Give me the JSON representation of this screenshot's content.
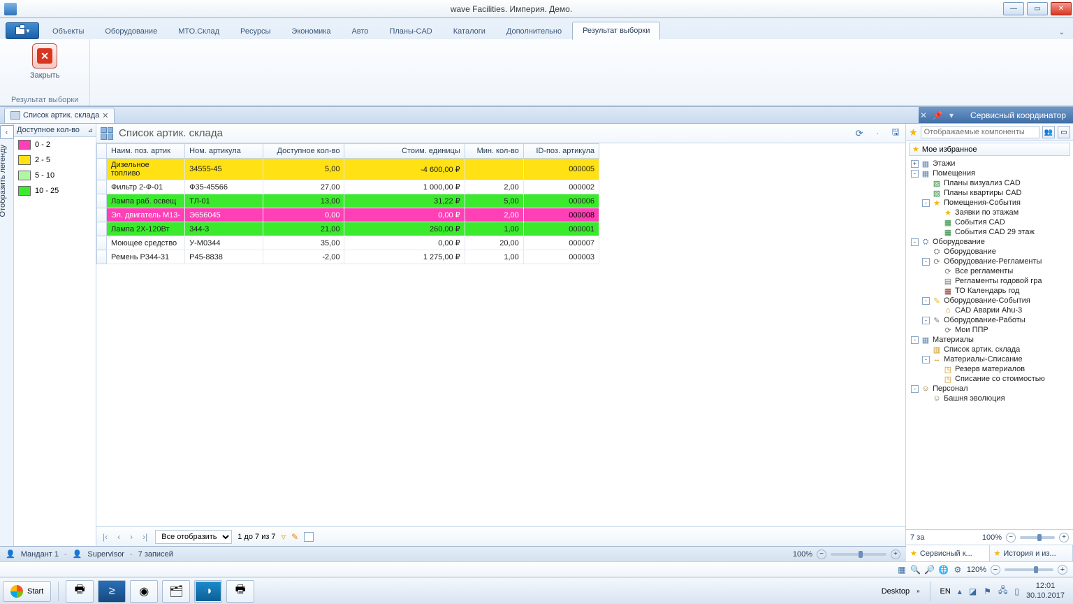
{
  "window": {
    "title": "wave Facilities. Империя. Демо."
  },
  "ribbon": {
    "tabs": [
      "Объекты",
      "Оборудование",
      "МТО.Склад",
      "Ресурсы",
      "Экономика",
      "Авто",
      "Планы-CAD",
      "Каталоги",
      "Дополнительно",
      "Результат выборки"
    ],
    "active_tab": "Результат выборки",
    "close_label": "Закрыть",
    "group_caption": "Результат выборки"
  },
  "doc_tab": {
    "title": "Список артик. склада"
  },
  "right_panel_title": "Сервисный координатор",
  "legend": {
    "header": "Доступное кол-во",
    "toggle_label": "Отобразить легенду",
    "items": [
      {
        "swatch": "sw-pink",
        "label": "0 - 2"
      },
      {
        "swatch": "sw-yellow",
        "label": "2 - 5"
      },
      {
        "swatch": "sw-lgreen",
        "label": "5 - 10"
      },
      {
        "swatch": "sw-green",
        "label": "10 - 25"
      }
    ]
  },
  "table": {
    "title": "Список артик. склада",
    "columns": [
      "Наим. поз. артик",
      "Ном. артикула",
      "Доступное кол-во",
      "Стоим. единицы",
      "Мин. кол-во",
      "ID-поз. артикула"
    ],
    "rows": [
      {
        "cls": "c-yellow",
        "cells": [
          "Дизельное топливо",
          "34555-45",
          "5,00",
          "-4 600,00 ₽",
          "",
          "000005"
        ]
      },
      {
        "cls": "",
        "cells": [
          "Фильтр 2-Ф-01",
          "Ф35-45566",
          "27,00",
          "1 000,00 ₽",
          "2,00",
          "000002"
        ]
      },
      {
        "cls": "c-green",
        "cells": [
          "Лампа раб. освещ",
          "ТЛ-01",
          "13,00",
          "31,22 ₽",
          "5,00",
          "000006"
        ]
      },
      {
        "cls": "c-pink",
        "cells": [
          "Эл. двигатель М13-",
          "Э656045",
          "0,00",
          "0,00 ₽",
          "2,00",
          "000008"
        ]
      },
      {
        "cls": "c-green",
        "cells": [
          "Лампа 2Х-120Вт",
          "344-3",
          "21,00",
          "260,00 ₽",
          "1,00",
          "000001"
        ]
      },
      {
        "cls": "",
        "cells": [
          "Моющее средство",
          "У-М0344",
          "35,00",
          "0,00 ₽",
          "20,00",
          "000007"
        ]
      },
      {
        "cls": "",
        "cells": [
          "Ремень Р344-31",
          "Р45-8838",
          "-2,00",
          "1 275,00 ₽",
          "1,00",
          "000003"
        ]
      }
    ]
  },
  "pager": {
    "show_all": "Все отобразить",
    "range": "1 до 7 из 7"
  },
  "statusbar": {
    "mandant": "Мандант 1",
    "user": "Supervisor",
    "records": "7 записей",
    "zoom": "100%"
  },
  "sidebar": {
    "search_placeholder": "Отображаемые компоненты",
    "favorites_header": "Мое избранное",
    "tree": [
      {
        "pm": "+",
        "ind": 0,
        "icon": "i-folder",
        "glyph": "▦",
        "label": "Этажи"
      },
      {
        "pm": "-",
        "ind": 0,
        "icon": "i-folder",
        "glyph": "▦",
        "label": "Помещения"
      },
      {
        "pm": "",
        "ind": 1,
        "icon": "i-cad",
        "glyph": "▧",
        "label": "Планы визуализ CAD"
      },
      {
        "pm": "",
        "ind": 1,
        "icon": "i-cad",
        "glyph": "▧",
        "label": "Планы квартиры CAD"
      },
      {
        "pm": "-",
        "ind": 1,
        "icon": "i-star",
        "glyph": "★",
        "label": "Помещения-События"
      },
      {
        "pm": "",
        "ind": 2,
        "icon": "i-star",
        "glyph": "★",
        "label": "Заявки по этажам"
      },
      {
        "pm": "",
        "ind": 2,
        "icon": "i-cad",
        "glyph": "▦",
        "label": "События CAD"
      },
      {
        "pm": "",
        "ind": 2,
        "icon": "i-cad",
        "glyph": "▦",
        "label": "События CAD 29 этаж"
      },
      {
        "pm": "-",
        "ind": 0,
        "icon": "i-folder",
        "glyph": "⛭",
        "label": "Оборудование"
      },
      {
        "pm": "",
        "ind": 1,
        "icon": "i-gear",
        "glyph": "⛭",
        "label": "Оборудование"
      },
      {
        "pm": "-",
        "ind": 1,
        "icon": "i-gear",
        "glyph": "⟳",
        "label": "Оборудование-Регламенты"
      },
      {
        "pm": "",
        "ind": 2,
        "icon": "i-gear",
        "glyph": "⟳",
        "label": "Все регламенты"
      },
      {
        "pm": "",
        "ind": 2,
        "icon": "i-gear",
        "glyph": "▤",
        "label": "Регламенты годовой гра"
      },
      {
        "pm": "",
        "ind": 2,
        "icon": "i-cal",
        "glyph": "▦",
        "label": "ТО Календарь год"
      },
      {
        "pm": "-",
        "ind": 1,
        "icon": "i-star",
        "glyph": "✎",
        "label": "Оборудование-События"
      },
      {
        "pm": "",
        "ind": 2,
        "icon": "i-box",
        "glyph": "⌂",
        "label": "CAD Аварии Ahu-3"
      },
      {
        "pm": "-",
        "ind": 1,
        "icon": "i-gear",
        "glyph": "✎",
        "label": "Оборудование-Работы"
      },
      {
        "pm": "",
        "ind": 2,
        "icon": "i-gear",
        "glyph": "⟳",
        "label": "Мои ППР"
      },
      {
        "pm": "-",
        "ind": 0,
        "icon": "i-folder",
        "glyph": "▦",
        "label": "Материалы"
      },
      {
        "pm": "",
        "ind": 1,
        "icon": "i-box",
        "glyph": "▥",
        "label": "Список артик. склада"
      },
      {
        "pm": "-",
        "ind": 1,
        "icon": "i-box",
        "glyph": "↔",
        "label": "Материалы-Списание"
      },
      {
        "pm": "",
        "ind": 2,
        "icon": "i-box",
        "glyph": "◳",
        "label": "Резерв материалов"
      },
      {
        "pm": "",
        "ind": 2,
        "icon": "i-box",
        "glyph": "◳",
        "label": "Списание со стоимостью"
      },
      {
        "pm": "-",
        "ind": 0,
        "icon": "i-person",
        "glyph": "☺",
        "label": "Персонал"
      },
      {
        "pm": "",
        "ind": 1,
        "icon": "i-person",
        "glyph": "☺",
        "label": "Башня эволюция"
      }
    ],
    "footer": {
      "count": "7 за",
      "zoom": "100%"
    },
    "tabs": [
      "Сервисный к...",
      "История и из..."
    ]
  },
  "globalstatus": {
    "zoom": "120%"
  },
  "taskbar": {
    "start": "Start",
    "desktop_label": "Desktop",
    "lang": "EN",
    "time": "12:01",
    "date": "30.10.2017"
  }
}
